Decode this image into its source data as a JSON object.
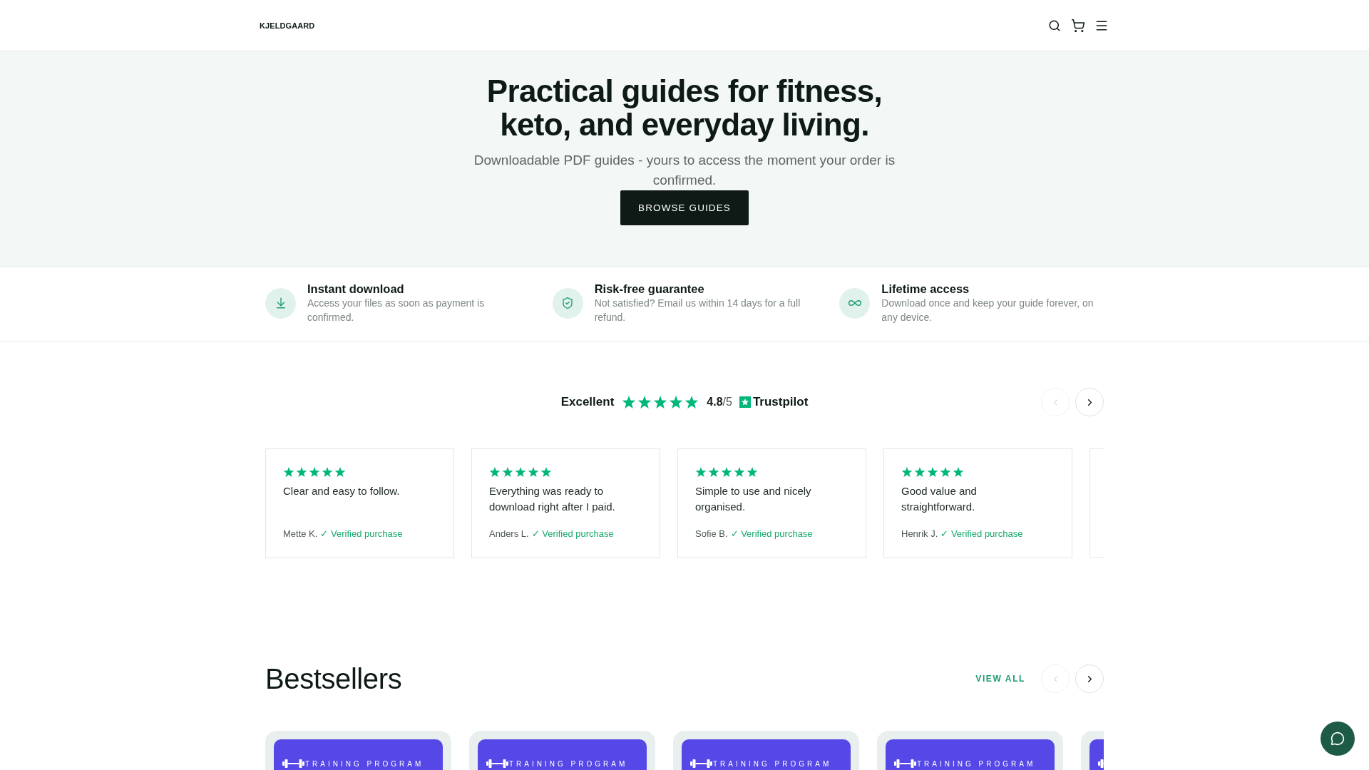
{
  "header": {
    "logo": "KJELDGAARD"
  },
  "hero": {
    "title": "Practical guides for fitness, keto, and everyday living.",
    "subtitle": "Downloadable PDF guides - yours to access the moment your order is confirmed.",
    "button": "BROWSE GUIDES"
  },
  "features": [
    {
      "kind": "download",
      "title": "Instant download",
      "text": "Access your files as soon as payment is confirmed."
    },
    {
      "kind": "guarantee",
      "title": "Risk-free guarantee",
      "text": "Not satisfied? Email us within 14 days for a full refund."
    },
    {
      "kind": "lifetime",
      "title": "Lifetime access",
      "text": "Download once and keep your guide forever, on any device."
    }
  ],
  "reviews_section": {
    "rating_label": "Excellent",
    "stars": 5,
    "score": "**4.8**/5",
    "brand": "Trustpilot",
    "nav": [
      {
        "kind": "prev",
        "disabled": true
      },
      {
        "kind": "next",
        "disabled": false
      }
    ],
    "reviews": [
      {
        "stars": 5,
        "text": "Clear and easy to follow.",
        "author": "Mette K.",
        "verified": "✓ Verified purchase"
      },
      {
        "stars": 5,
        "text": "Everything was ready to download right after I paid.",
        "author": "Anders L.",
        "verified": "✓ Verified purchase"
      },
      {
        "stars": 5,
        "text": "Simple to use and nicely organised.",
        "author": "Sofie B.",
        "verified": "✓ Verified purchase"
      },
      {
        "stars": 5,
        "text": "Good value and straightforward.",
        "author": "Henrik J.",
        "verified": "✓ Verified purchase"
      }
    ]
  },
  "bestsellers": {
    "title": "Bestsellers",
    "view_all": "VIEW ALL",
    "nav": [
      {
        "kind": "prev",
        "disabled": true
      },
      {
        "kind": "next",
        "disabled": false
      }
    ],
    "products": [
      {
        "tag": "TRAINING PROGRAM"
      },
      {
        "tag": "TRAINING PROGRAM"
      },
      {
        "tag": "TRAINING PROGRAM"
      },
      {
        "tag": "TRAINING PROGRAM"
      }
    ]
  }
}
